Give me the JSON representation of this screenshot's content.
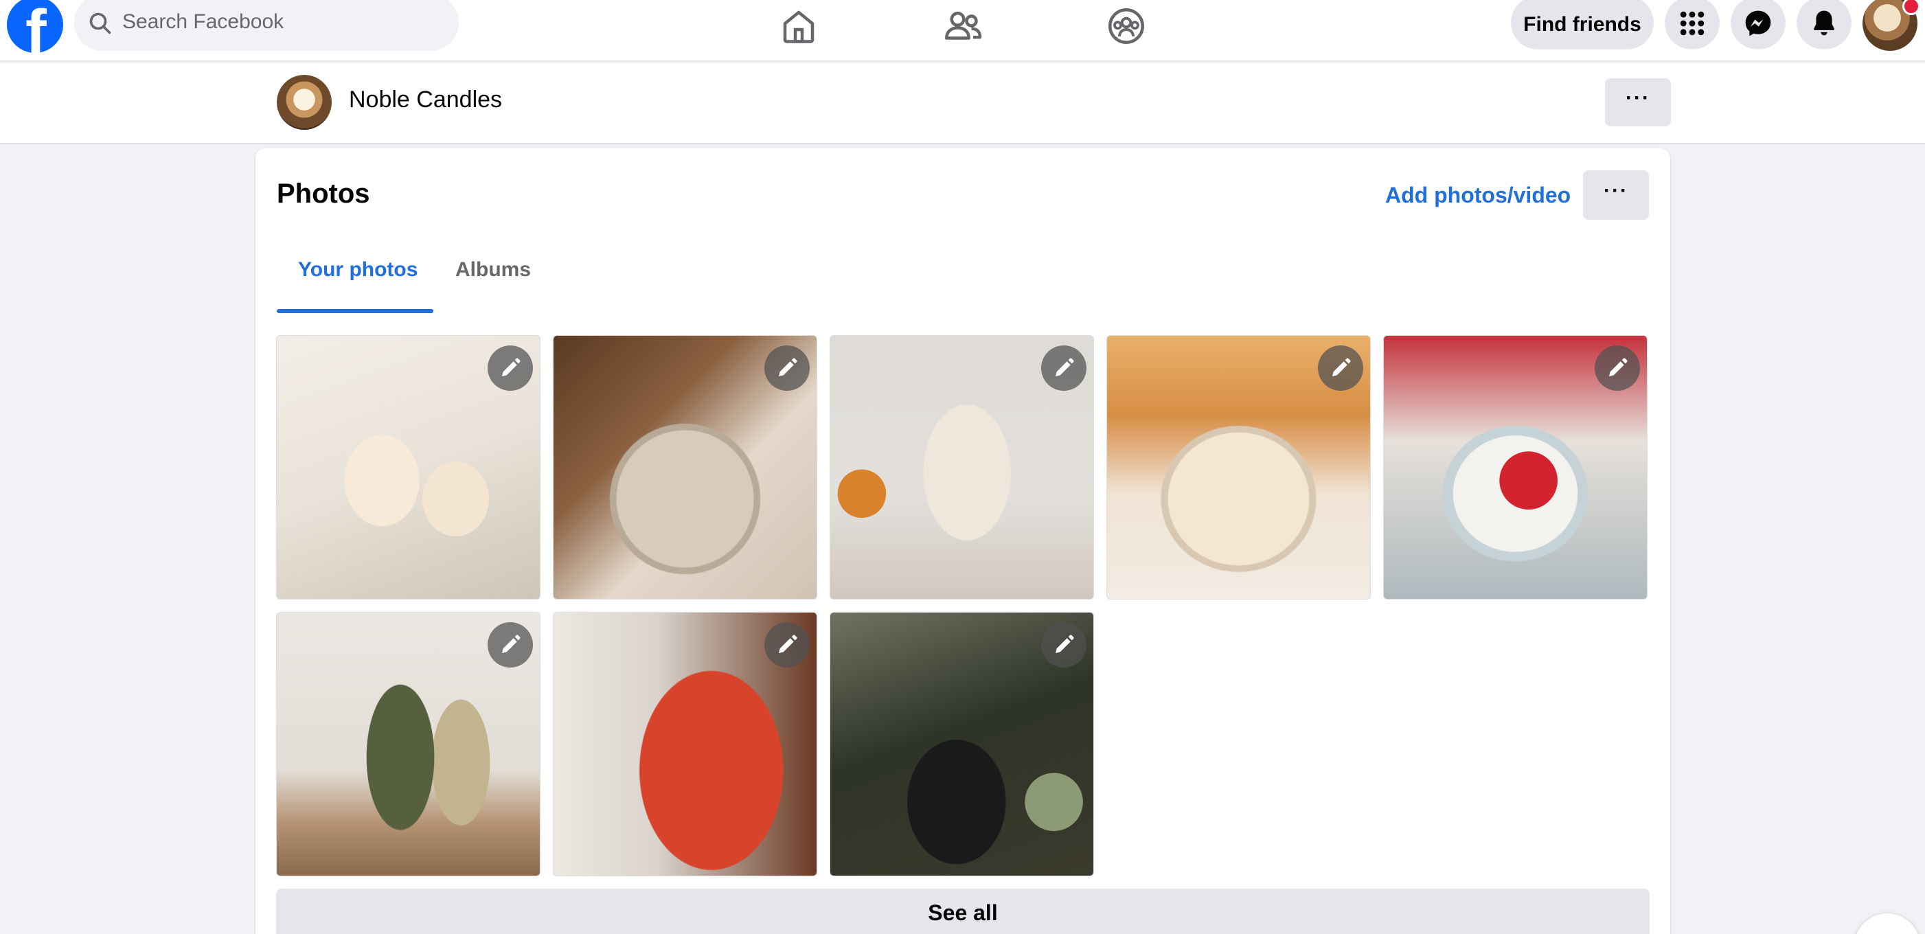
{
  "topbar": {
    "logo": "f",
    "search_placeholder": "Search Facebook",
    "nav_icons": [
      "home-icon",
      "friends-icon",
      "groups-icon"
    ],
    "find_friends_label": "Find friends",
    "right_icons": [
      "menu-grid-icon",
      "messenger-icon",
      "bell-icon"
    ],
    "brand_color": "#0866ff"
  },
  "page": {
    "name": "Noble Candles"
  },
  "photos": {
    "title": "Photos",
    "add_label": "Add photos/video",
    "tabs": [
      {
        "label": "Your photos",
        "active": true
      },
      {
        "label": "Albums",
        "active": false
      }
    ],
    "items": [
      {
        "alt": "candle-photo-1"
      },
      {
        "alt": "candle-photo-2"
      },
      {
        "alt": "candle-photo-3"
      },
      {
        "alt": "candle-photo-4"
      },
      {
        "alt": "candle-photo-5"
      },
      {
        "alt": "candle-photo-6"
      },
      {
        "alt": "candle-photo-7"
      },
      {
        "alt": "candle-photo-8"
      }
    ],
    "see_all_label": "See all",
    "accent_color": "#216fdb"
  }
}
